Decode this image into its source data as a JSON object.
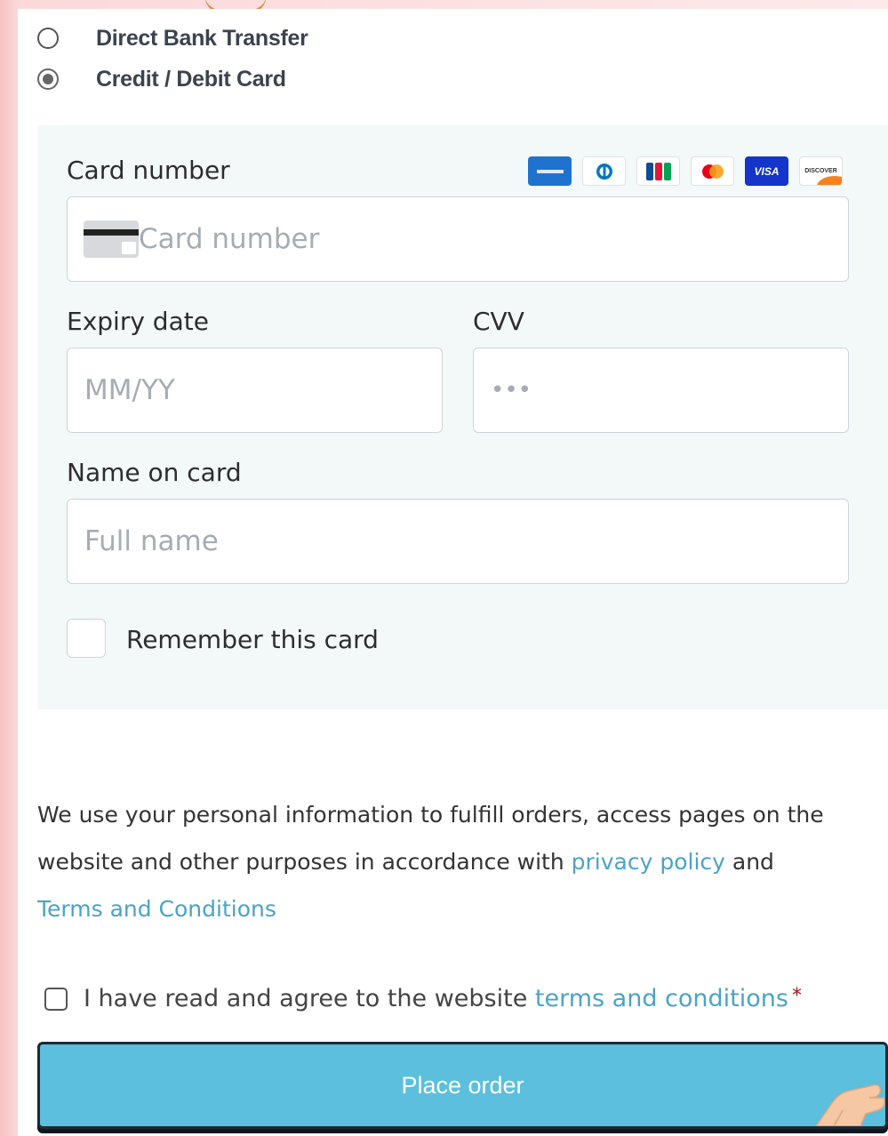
{
  "payment_methods": [
    {
      "label": "Direct Bank Transfer",
      "selected": false
    },
    {
      "label": "Credit / Debit Card",
      "selected": true
    }
  ],
  "card_form": {
    "card_number_label": "Card number",
    "card_number_placeholder": "Card number",
    "accepted_brands": [
      "amex-icon",
      "diners-icon",
      "jcb-icon",
      "mastercard-icon",
      "visa-icon",
      "discover-icon"
    ],
    "visa_text": "VISA",
    "discover_text": "DISCOVER",
    "expiry_label": "Expiry date",
    "expiry_placeholder": "MM/YY",
    "cvv_label": "CVV",
    "cvv_placeholder": "•••",
    "name_label": "Name on card",
    "name_placeholder": "Full name",
    "remember_label": "Remember this card"
  },
  "privacy": {
    "text_before": "We use your personal information to fulfill orders, access pages on the website and other purposes in accordance with ",
    "privacy_link": "privacy policy",
    "text_middle": " and ",
    "terms_link": "Terms and Conditions"
  },
  "agreement": {
    "text": "I have read and agree to the website ",
    "link": "terms and conditions",
    "required_mark": "*"
  },
  "place_order": {
    "label": "Place order"
  },
  "colors": {
    "accent": "#5bbfdd",
    "link": "#4ba3c7",
    "card_box_bg": "#f3f8f9",
    "page_bg": "#fde9ea"
  }
}
